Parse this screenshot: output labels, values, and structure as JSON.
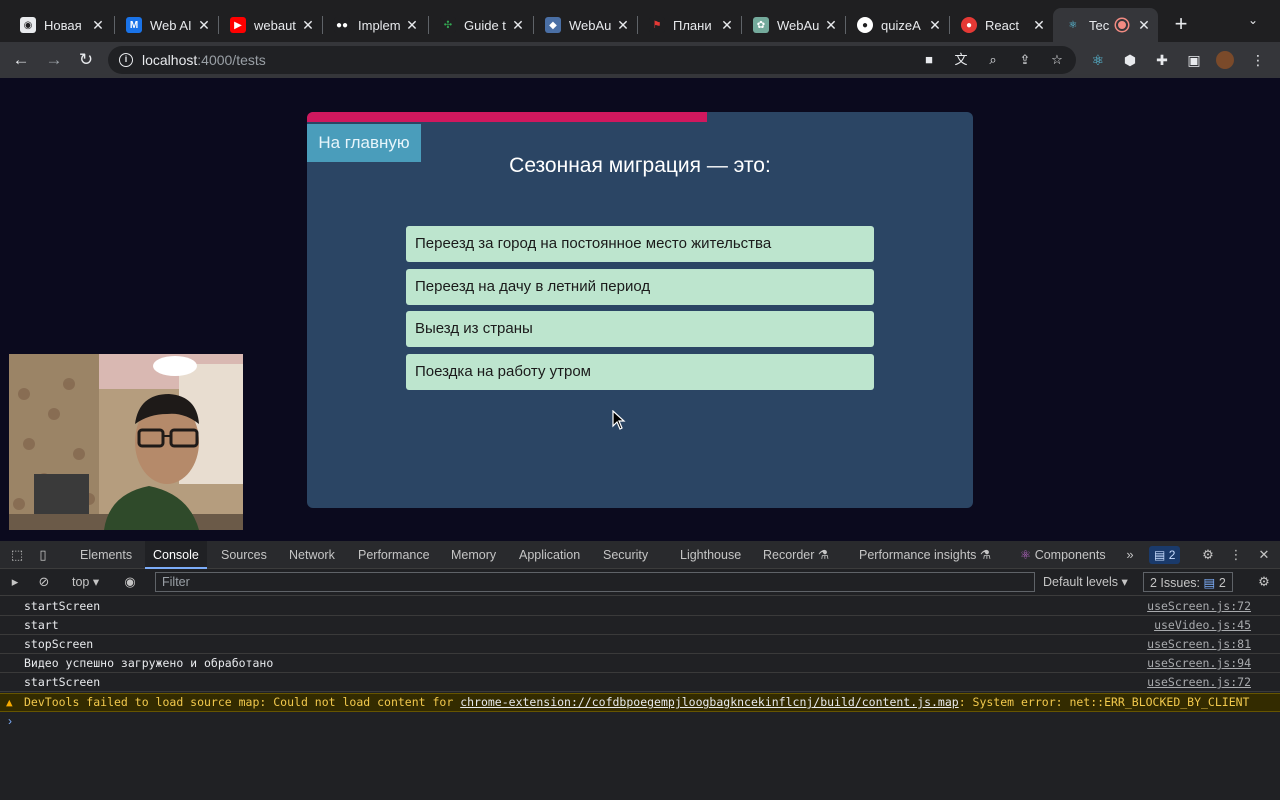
{
  "browser": {
    "tabs": [
      {
        "title": "Новая",
        "favicon": "chrome-icon",
        "color": "#e8eaed"
      },
      {
        "title": "Web AI",
        "favicon": "webai-icon",
        "color": "#1a73e8"
      },
      {
        "title": "webaut",
        "favicon": "youtube-icon",
        "color": "#ff0000"
      },
      {
        "title": "Implem",
        "favicon": "medium-icon",
        "color": "#000000"
      },
      {
        "title": "Guide t",
        "favicon": "guide-icon",
        "color": "#34a853"
      },
      {
        "title": "WebAu",
        "favicon": "webauthn-icon",
        "color": "#4a6fa5"
      },
      {
        "title": "Плани",
        "favicon": "plan-icon",
        "color": "#e53935"
      },
      {
        "title": "WebAu",
        "favicon": "openai-icon",
        "color": "#74aa9c"
      },
      {
        "title": "quizeA",
        "favicon": "github-icon",
        "color": "#ffffff"
      },
      {
        "title": "React",
        "favicon": "react-record-icon",
        "color": "#e53935"
      },
      {
        "title": "Tec",
        "favicon": "react-icon",
        "color": "#61dafb"
      }
    ],
    "url_host": "localhost",
    "url_path": ":4000/tests"
  },
  "quiz": {
    "home_button": "На главную",
    "progress": 0.6,
    "question": "Сезонная миграция — это:",
    "answers": [
      "Переезд за город на постоянное место жительства",
      "Переезд на дачу в летний период",
      "Выезд из страны",
      "Поездка на работу утром"
    ]
  },
  "devtools": {
    "tabs": [
      "Elements",
      "Console",
      "Sources",
      "Network",
      "Performance",
      "Memory",
      "Application",
      "Security",
      "Lighthouse",
      "Recorder",
      "Performance insights",
      "Components"
    ],
    "active_tab": "Console",
    "issues_badge": "2",
    "context": "top",
    "filter_placeholder": "Filter",
    "levels": "Default levels",
    "issues_label": "2 Issues:",
    "issues_count": "2",
    "logs": [
      {
        "msg": "startScreen",
        "src": "useScreen.js:72"
      },
      {
        "msg": "start",
        "src": "useVideo.js:45"
      },
      {
        "msg": "stopScreen",
        "src": "useScreen.js:81"
      },
      {
        "msg": "Видео успешно загружено и обработано",
        "src": "useScreen.js:94"
      },
      {
        "msg": "startScreen",
        "src": "useScreen.js:72"
      }
    ],
    "warning": {
      "prefix": "DevTools failed to load source map: Could not load content for ",
      "link": "chrome-extension://cofdbpoegempjloogbagkncekinflcnj/build/content.js.map",
      "suffix": ": System error: net::ERR_BLOCKED_BY_CLIENT"
    }
  }
}
